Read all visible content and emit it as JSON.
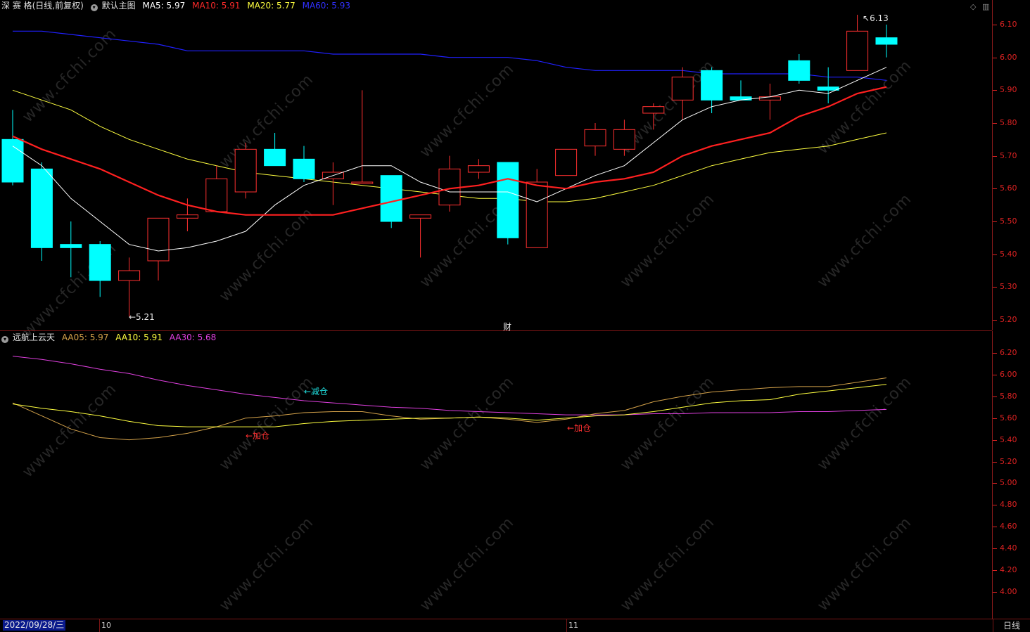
{
  "header": {
    "stock": "深 赛 格(日线,前复权)",
    "main_chart": "默认主图",
    "ma5": "MA5: 5.97",
    "ma10": "MA10: 5.91",
    "ma20": "MA20: 5.77",
    "ma60": "MA60: 5.93"
  },
  "indicator_header": {
    "name": "远航上云天",
    "aa05": "AA05: 5.97",
    "aa10": "AA10: 5.91",
    "aa30": "AA30: 5.68"
  },
  "colors": {
    "up": "#ff3030",
    "down": "#00ffff",
    "ma5": "#ffffff",
    "ma10": "#ff2020",
    "ma20": "#ffff40",
    "ma60": "#2020ff",
    "aa05": "#d4a24a",
    "aa10": "#ffff40",
    "aa30": "#e040e0",
    "axis": "#dd2222"
  },
  "price_axis": [
    "6.10",
    "6.00",
    "5.90",
    "5.80",
    "5.70",
    "5.60",
    "5.50",
    "5.40",
    "5.30",
    "5.20"
  ],
  "indicator_axis": [
    "6.20",
    "6.00",
    "5.80",
    "5.60",
    "5.40",
    "5.20",
    "5.00",
    "4.80",
    "4.60",
    "4.40",
    "4.20",
    "4.00"
  ],
  "annotations": {
    "high_marker": "6.13",
    "low_marker": "←5.21",
    "finance_marker": "财",
    "reduce_1": "←减仓",
    "add_1": "←加仓",
    "add_2": "←加仓"
  },
  "footer": {
    "current_date": "2022/09/28/三",
    "month_oct": "10",
    "month_nov": "11",
    "period": "日线"
  },
  "watermark": "www.cfchi.com",
  "chart_data": {
    "type": "candlestick",
    "price_range": [
      5.18,
      6.12
    ],
    "candles": [
      {
        "o": 5.75,
        "h": 5.84,
        "l": 5.61,
        "c": 5.62
      },
      {
        "o": 5.66,
        "h": 5.68,
        "l": 5.38,
        "c": 5.42
      },
      {
        "o": 5.43,
        "h": 5.5,
        "l": 5.33,
        "c": 5.42
      },
      {
        "o": 5.43,
        "h": 5.44,
        "l": 5.27,
        "c": 5.32
      },
      {
        "o": 5.32,
        "h": 5.39,
        "l": 5.21,
        "c": 5.35
      },
      {
        "o": 5.38,
        "h": 5.51,
        "l": 5.32,
        "c": 5.51
      },
      {
        "o": 5.51,
        "h": 5.57,
        "l": 5.47,
        "c": 5.52
      },
      {
        "o": 5.53,
        "h": 5.67,
        "l": 5.53,
        "c": 5.63
      },
      {
        "o": 5.59,
        "h": 5.74,
        "l": 5.57,
        "c": 5.72
      },
      {
        "o": 5.72,
        "h": 5.77,
        "l": 5.67,
        "c": 5.67
      },
      {
        "o": 5.69,
        "h": 5.73,
        "l": 5.62,
        "c": 5.63
      },
      {
        "o": 5.63,
        "h": 5.68,
        "l": 5.55,
        "c": 5.65
      },
      {
        "o": 5.62,
        "h": 5.9,
        "l": 5.62,
        "c": 5.62
      },
      {
        "o": 5.64,
        "h": 5.64,
        "l": 5.48,
        "c": 5.5
      },
      {
        "o": 5.51,
        "h": 5.52,
        "l": 5.39,
        "c": 5.52
      },
      {
        "o": 5.55,
        "h": 5.7,
        "l": 5.53,
        "c": 5.66
      },
      {
        "o": 5.65,
        "h": 5.69,
        "l": 5.63,
        "c": 5.67
      },
      {
        "o": 5.68,
        "h": 5.68,
        "l": 5.43,
        "c": 5.45
      },
      {
        "o": 5.42,
        "h": 5.66,
        "l": 5.42,
        "c": 5.62
      },
      {
        "o": 5.64,
        "h": 5.72,
        "l": 5.64,
        "c": 5.72
      },
      {
        "o": 5.73,
        "h": 5.8,
        "l": 5.7,
        "c": 5.78
      },
      {
        "o": 5.72,
        "h": 5.81,
        "l": 5.7,
        "c": 5.78
      },
      {
        "o": 5.83,
        "h": 5.86,
        "l": 5.78,
        "c": 5.85
      },
      {
        "o": 5.87,
        "h": 5.97,
        "l": 5.81,
        "c": 5.94
      },
      {
        "o": 5.96,
        "h": 5.97,
        "l": 5.83,
        "c": 5.87
      },
      {
        "o": 5.88,
        "h": 5.93,
        "l": 5.87,
        "c": 5.87
      },
      {
        "o": 5.87,
        "h": 5.92,
        "l": 5.81,
        "c": 5.88
      },
      {
        "o": 5.99,
        "h": 6.01,
        "l": 5.92,
        "c": 5.93
      },
      {
        "o": 5.91,
        "h": 5.97,
        "l": 5.86,
        "c": 5.9
      },
      {
        "o": 5.96,
        "h": 6.13,
        "l": 5.96,
        "c": 6.08
      },
      {
        "o": 6.06,
        "h": 6.1,
        "l": 6.0,
        "c": 6.04
      }
    ],
    "ma5": [
      5.73,
      5.67,
      5.57,
      5.5,
      5.43,
      5.41,
      5.42,
      5.44,
      5.47,
      5.55,
      5.61,
      5.64,
      5.67,
      5.67,
      5.62,
      5.59,
      5.59,
      5.59,
      5.56,
      5.6,
      5.64,
      5.67,
      5.74,
      5.81,
      5.85,
      5.87,
      5.88,
      5.9,
      5.89,
      5.93,
      5.97
    ],
    "ma10": [
      5.76,
      5.72,
      5.69,
      5.66,
      5.62,
      5.58,
      5.55,
      5.53,
      5.52,
      5.52,
      5.52,
      5.52,
      5.54,
      5.56,
      5.58,
      5.6,
      5.61,
      5.63,
      5.61,
      5.6,
      5.62,
      5.63,
      5.65,
      5.7,
      5.73,
      5.75,
      5.77,
      5.82,
      5.85,
      5.89,
      5.91
    ],
    "ma20": [
      5.9,
      5.87,
      5.84,
      5.79,
      5.75,
      5.72,
      5.69,
      5.67,
      5.65,
      5.64,
      5.63,
      5.62,
      5.61,
      5.6,
      5.59,
      5.58,
      5.57,
      5.57,
      5.56,
      5.56,
      5.57,
      5.59,
      5.61,
      5.64,
      5.67,
      5.69,
      5.71,
      5.72,
      5.73,
      5.75,
      5.77
    ],
    "ma60": [
      6.08,
      6.08,
      6.07,
      6.06,
      6.05,
      6.04,
      6.02,
      6.02,
      6.02,
      6.02,
      6.02,
      6.01,
      6.01,
      6.01,
      6.01,
      6.0,
      6.0,
      6.0,
      5.99,
      5.97,
      5.96,
      5.96,
      5.96,
      5.96,
      5.95,
      5.95,
      5.95,
      5.95,
      5.94,
      5.94,
      5.93
    ],
    "indicator_range": [
      3.9,
      6.32
    ],
    "aa05": [
      5.74,
      5.62,
      5.5,
      5.42,
      5.4,
      5.42,
      5.46,
      5.52,
      5.6,
      5.62,
      5.65,
      5.66,
      5.66,
      5.62,
      5.59,
      5.6,
      5.61,
      5.59,
      5.56,
      5.59,
      5.64,
      5.67,
      5.75,
      5.8,
      5.84,
      5.86,
      5.88,
      5.89,
      5.89,
      5.93,
      5.97
    ],
    "aa10": [
      5.73,
      5.69,
      5.66,
      5.62,
      5.57,
      5.53,
      5.52,
      5.52,
      5.52,
      5.52,
      5.55,
      5.57,
      5.58,
      5.59,
      5.6,
      5.6,
      5.61,
      5.6,
      5.58,
      5.6,
      5.62,
      5.63,
      5.66,
      5.7,
      5.74,
      5.76,
      5.77,
      5.82,
      5.85,
      5.88,
      5.91
    ],
    "aa30": [
      6.17,
      6.14,
      6.1,
      6.05,
      6.01,
      5.95,
      5.9,
      5.86,
      5.82,
      5.79,
      5.76,
      5.74,
      5.72,
      5.7,
      5.69,
      5.67,
      5.66,
      5.65,
      5.64,
      5.63,
      5.63,
      5.63,
      5.64,
      5.64,
      5.65,
      5.65,
      5.65,
      5.66,
      5.66,
      5.67,
      5.68
    ]
  }
}
